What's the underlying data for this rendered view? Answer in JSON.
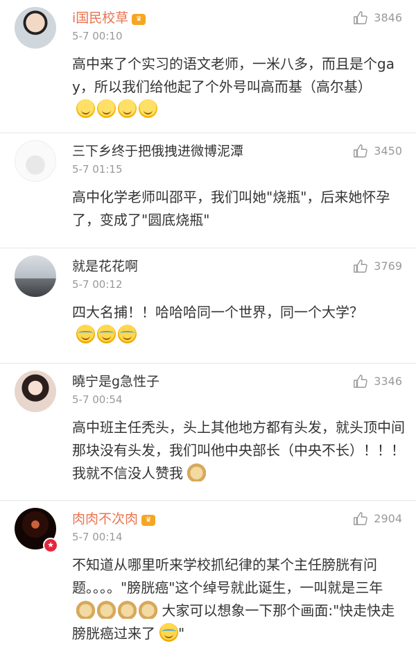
{
  "comments": [
    {
      "username": "i国民校草",
      "vip_badge": "crown-icon",
      "time": "5-7 00:10",
      "likes": "3846",
      "text": "高中来了个实习的语文老师，一米八多，而且是个gay，所以我们给他起了个外号叫高而基（高尔基）",
      "emojis": [
        "smile",
        "smile",
        "smile",
        "smile"
      ]
    },
    {
      "username": "三下乡终于把俄拽进微博泥潭",
      "time": "5-7 01:15",
      "likes": "3450",
      "text": "高中化学老师叫邵平，我们叫她\"烧瓶\"，后来她怀孕了，变成了\"圆底烧瓶\""
    },
    {
      "username": "就是花花啊",
      "time": "5-7 00:12",
      "likes": "3769",
      "text": "四大名捕！！哈哈哈同一个世界，同一个大学？",
      "emojis": [
        "laugh",
        "laugh",
        "laugh"
      ]
    },
    {
      "username": "曉宁是g急性子",
      "time": "5-7 00:54",
      "likes": "3346",
      "text": "高中班主任秃头，头上其他地方都有头发，就头顶中间那块没有头发，我们叫他中央部长（中央不长）！！！我就不信没人赞我",
      "emojis": [
        "doge"
      ]
    },
    {
      "username": "肉肉不次肉",
      "vip_badge": "crown-icon",
      "time": "5-7 00:14",
      "likes": "2904",
      "text_part1": "不知道从哪里听来学校抓纪律的某个主任膀胱有问题。。。。\"膀胱癌\"这个绰号就此诞生，一叫就是三年",
      "text_part2": "大家可以想象一下那个画面:\"快走快走 膀胱癌过来了",
      "text_part3": "\"",
      "emojis_mid": [
        "doge",
        "doge",
        "doge",
        "doge"
      ],
      "emojis_end": [
        "laugh"
      ]
    }
  ],
  "colors": {
    "vip_name": "#eb7350",
    "name": "#333333",
    "meta": "#999999",
    "divider": "#e6e6e6",
    "vip_badge": "#e5263b"
  }
}
